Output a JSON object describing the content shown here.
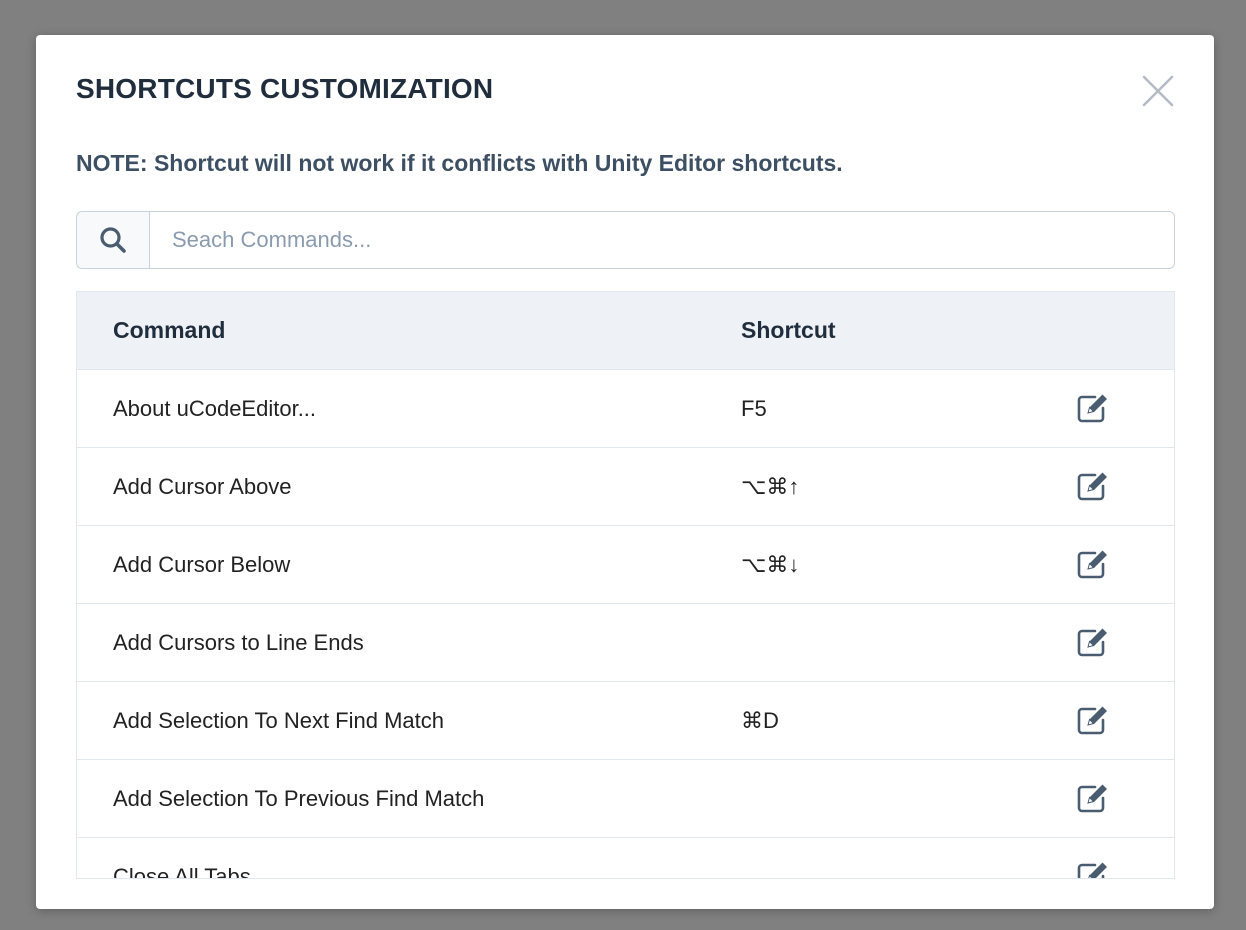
{
  "dialog": {
    "title": "SHORTCUTS CUSTOMIZATION",
    "note": "NOTE: Shortcut will not work if it conflicts with Unity Editor shortcuts."
  },
  "search": {
    "placeholder": "Seach Commands...",
    "value": ""
  },
  "table": {
    "headers": {
      "command": "Command",
      "shortcut": "Shortcut"
    },
    "rows": [
      {
        "command": "About uCodeEditor...",
        "shortcut": "F5"
      },
      {
        "command": "Add Cursor Above",
        "shortcut": "⌥⌘↑"
      },
      {
        "command": "Add Cursor Below",
        "shortcut": "⌥⌘↓"
      },
      {
        "command": "Add Cursors to Line Ends",
        "shortcut": ""
      },
      {
        "command": "Add Selection To Next Find Match",
        "shortcut": "⌘D"
      },
      {
        "command": "Add Selection To Previous Find Match",
        "shortcut": ""
      },
      {
        "command": "Close All Tabs",
        "shortcut": ""
      }
    ]
  },
  "icons": {
    "close": "close-icon",
    "search": "search-icon",
    "edit": "edit-icon"
  },
  "colors": {
    "backdrop": "#808080",
    "title_text": "#1f2d3d",
    "header_bg": "#eef2f6",
    "border": "#e1e7ee",
    "icon": "#4a5c70"
  }
}
